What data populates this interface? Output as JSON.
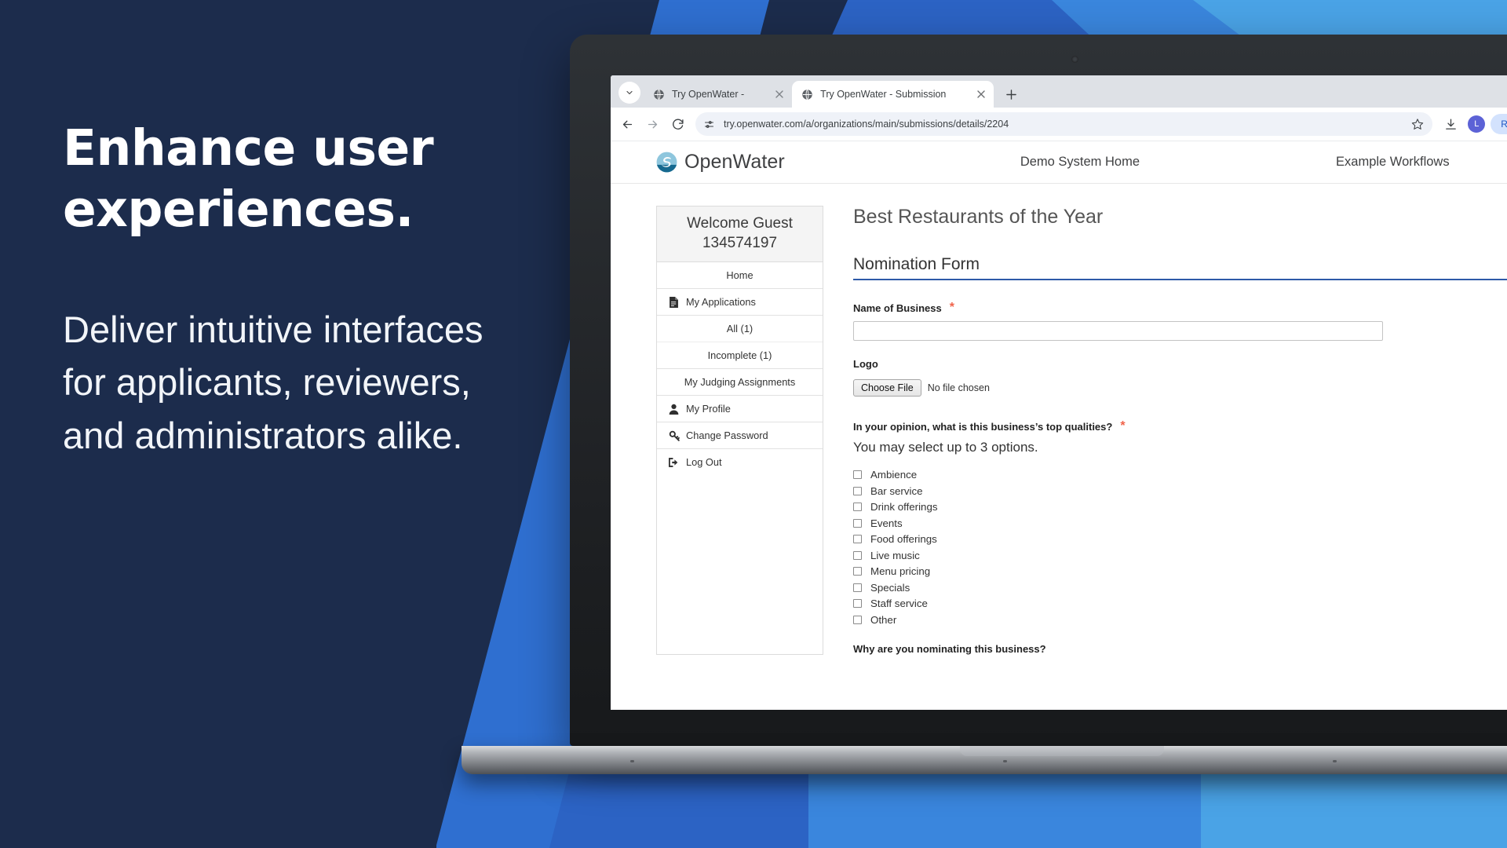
{
  "marketing": {
    "headline": "Enhance user experiences.",
    "subhead": "Deliver intuitive interfaces for applicants, reviewers, and administrators alike.",
    "bg_color": "#1c2c4c",
    "accent_blues": [
      "#2f6fd0",
      "#3a86dd",
      "#4aa3e6",
      "#2c63c4"
    ]
  },
  "browser": {
    "tabs": [
      {
        "title": "Try OpenWater -",
        "active": false,
        "favicon": "globe-icon"
      },
      {
        "title": "Try OpenWater - Submission",
        "active": true,
        "favicon": "globe-icon"
      }
    ],
    "new_tab_label": "+",
    "nav": {
      "back": "back-arrow",
      "forward": "forward-arrow",
      "reload": "reload-icon"
    },
    "omnibox": {
      "url": "try.openwater.com/a/organizations/main/submissions/details/2204",
      "site_settings_icon": "tune-icon",
      "bookmark_icon": "star-icon"
    },
    "downloads_icon": "download-icon",
    "profile_avatar_initial": "L",
    "profile_avatar_color": "#5c62d6",
    "relaunch_label": "Relaunch",
    "relaunch_color": "#d3e2fd"
  },
  "site": {
    "brand": "OpenWater",
    "nav_links": [
      "Demo System Home",
      "Example Workflows"
    ]
  },
  "sidebar": {
    "welcome_line1": "Welcome Guest",
    "welcome_line2": "134574197",
    "items": [
      {
        "label": "Home",
        "icon": null,
        "style": "center"
      },
      {
        "label": "My Applications",
        "icon": "document-icon",
        "style": "icon"
      },
      {
        "label": "All (1)",
        "icon": null,
        "style": "sub"
      },
      {
        "label": "Incomplete (1)",
        "icon": null,
        "style": "sub"
      },
      {
        "label": "My Judging Assignments",
        "icon": null,
        "style": "center"
      },
      {
        "label": "My Profile",
        "icon": "user-icon",
        "style": "icon"
      },
      {
        "label": "Change Password",
        "icon": "key-icon",
        "style": "icon"
      },
      {
        "label": "Log Out",
        "icon": "logout-icon",
        "style": "icon"
      }
    ]
  },
  "form": {
    "program_title": "Best Restaurants of the Year",
    "section_title": "Nomination Form",
    "section_underline_color": "#2e5aa8",
    "required_marker": "*",
    "fields": {
      "business_name": {
        "label": "Name of Business",
        "required": true,
        "value": ""
      },
      "logo": {
        "label": "Logo",
        "required": false,
        "button_label": "Choose File",
        "status": "No file chosen"
      },
      "qualities": {
        "label": "In your opinion, what is this business’s top qualities?",
        "required": true,
        "hint": "You may select up to 3 options.",
        "options": [
          "Ambience",
          "Bar service",
          "Drink offerings",
          "Events",
          "Food offerings",
          "Live music",
          "Menu pricing",
          "Specials",
          "Staff service",
          "Other"
        ]
      },
      "reason": {
        "label": "Why are you nominating this business?"
      }
    }
  }
}
